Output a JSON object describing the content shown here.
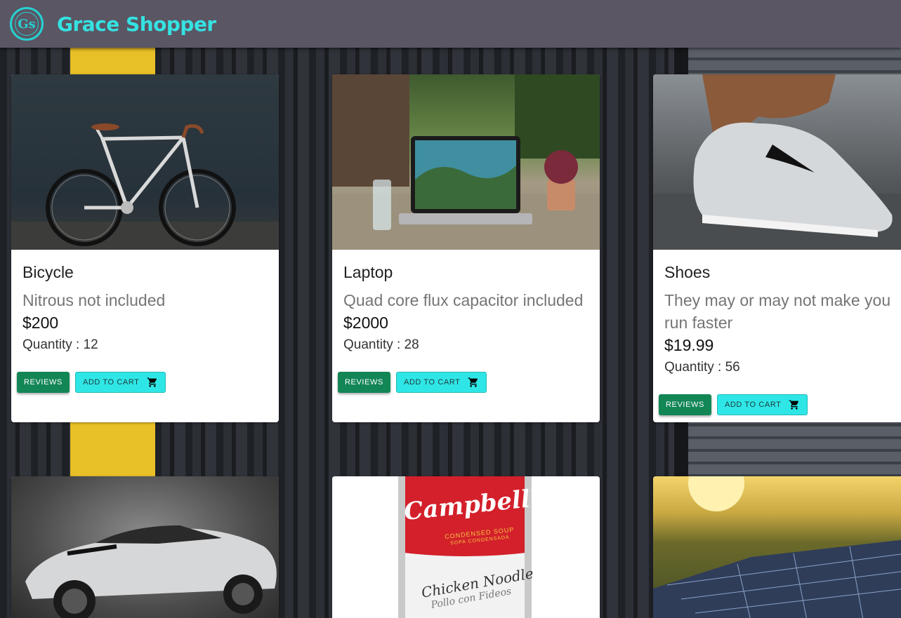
{
  "header": {
    "logo_text": "Gs",
    "brand": "Grace Shopper"
  },
  "products": [
    {
      "title": "Bicycle",
      "description": "Nitrous not included",
      "price": "$200",
      "quantity": "Quantity : 12",
      "reviews_label": "REVIEWS",
      "cart_label": "ADD TO CART"
    },
    {
      "title": "Laptop",
      "description": "Quad core flux capacitor included",
      "price": "$2000",
      "quantity": "Quantity : 28",
      "reviews_label": "REVIEWS",
      "cart_label": "ADD TO CART"
    },
    {
      "title": "Shoes",
      "description": "They may or may not make you run faster",
      "price": "$19.99",
      "quantity": "Quantity : 56",
      "reviews_label": "REVIEWS",
      "cart_label": "ADD TO CART"
    }
  ],
  "soup_label": {
    "brand": "Campbell's",
    "sub": "CONDENSED SOUP",
    "sub2": "SOPA CONDENSADA",
    "flavor": "Chicken Noodle",
    "flavor_es": "Pollo con Fideos"
  },
  "colors": {
    "header_bg": "#5a5664",
    "brand_accent": "#35e2e2",
    "reviews_button": "#138656",
    "cart_button": "#2fe6e6"
  },
  "icons": [
    "shopping-cart-icon"
  ]
}
